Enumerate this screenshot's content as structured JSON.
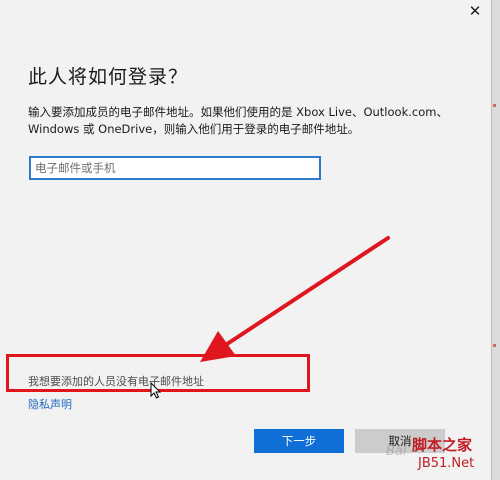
{
  "window": {
    "close_glyph": "✕",
    "close_icon": "close-icon"
  },
  "main": {
    "heading": "此人将如何登录？",
    "description": "输入要添加成员的电子邮件地址。如果他们使用的是 Xbox Live、Outlook.com、Windows 或 OneDrive，则输入他们用于登录的电子邮件地址。",
    "email_field": {
      "value": "",
      "placeholder": "电子邮件或手机"
    },
    "no_email_link": "我想要添加的人员没有电子邮件地址",
    "privacy_link": "隐私声明"
  },
  "footer": {
    "next_label": "下一步",
    "cancel_label": "取消"
  },
  "annotation": {
    "highlight_color": "#e0161e",
    "arrow_color": "#e0161e"
  },
  "watermark": {
    "logo_text": "脚本之家",
    "site_text": "JB51.Net",
    "baidu_text": "Bai"
  },
  "colors": {
    "accent": "#0f6fd6",
    "link": "#1f68c1",
    "input_border": "#2b79c8",
    "background": "#f2f2f2"
  }
}
